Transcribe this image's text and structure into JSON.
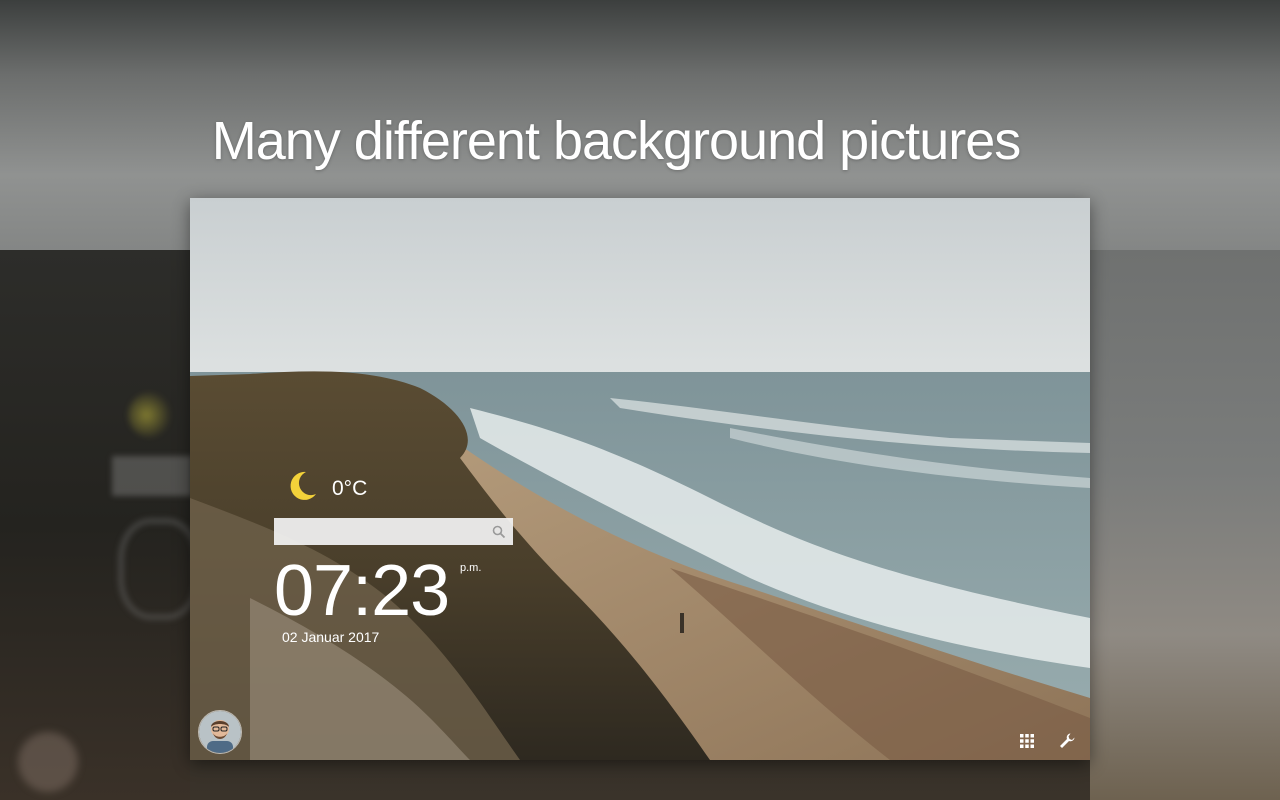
{
  "promo": {
    "headline": "Many different background pictures"
  },
  "newtab": {
    "weather": {
      "icon": "crescent-moon-icon",
      "temperature": "0°C"
    },
    "search": {
      "placeholder": "",
      "icon": "search-icon"
    },
    "clock": {
      "time": "07:23",
      "period": "p.m.",
      "date": "02 Januar 2017"
    },
    "footer": {
      "avatar_icon": "user-avatar",
      "apps_icon": "apps-grid-icon",
      "settings_icon": "wrench-icon"
    }
  },
  "colors": {
    "moon": "#f3d23a",
    "text": "#ffffff",
    "search_bg": "#f2f2f2"
  }
}
